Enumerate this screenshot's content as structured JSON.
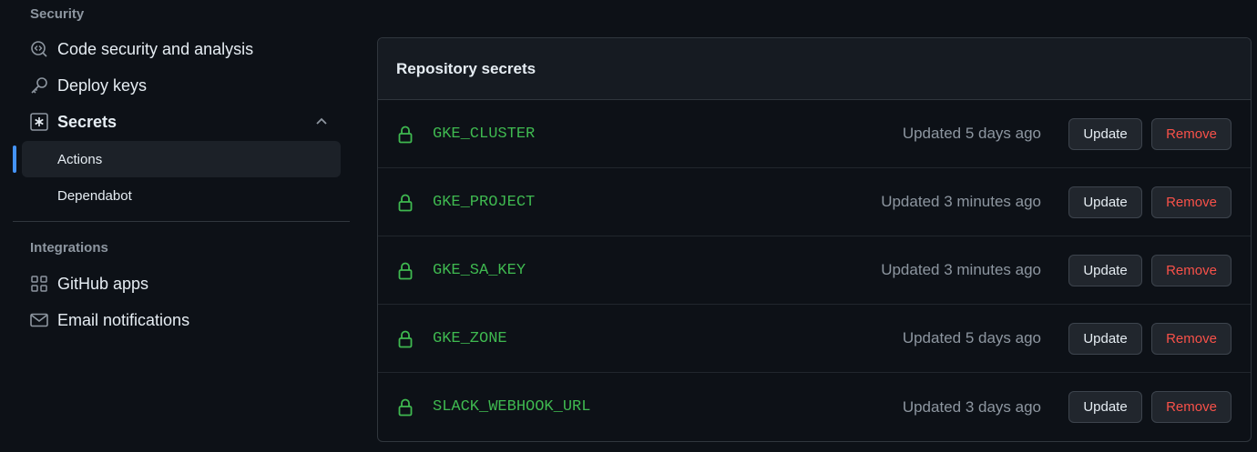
{
  "sidebar": {
    "security_heading": "Security",
    "items": [
      {
        "label": "Code security and analysis",
        "icon": "codescan-icon"
      },
      {
        "label": "Deploy keys",
        "icon": "key-icon"
      },
      {
        "label": "Secrets",
        "icon": "asterisk-icon"
      }
    ],
    "sub_items": [
      {
        "label": "Actions",
        "active": true
      },
      {
        "label": "Dependabot",
        "active": false
      }
    ],
    "integrations_heading": "Integrations",
    "integration_items": [
      {
        "label": "GitHub apps",
        "icon": "apps-icon"
      },
      {
        "label": "Email notifications",
        "icon": "mail-icon"
      }
    ]
  },
  "main": {
    "title": "Repository secrets",
    "update_label": "Update",
    "remove_label": "Remove",
    "secrets": [
      {
        "name": "GKE_CLUSTER",
        "updated": "Updated 5 days ago"
      },
      {
        "name": "GKE_PROJECT",
        "updated": "Updated 3 minutes ago"
      },
      {
        "name": "GKE_SA_KEY",
        "updated": "Updated 3 minutes ago"
      },
      {
        "name": "GKE_ZONE",
        "updated": "Updated 5 days ago"
      },
      {
        "name": "SLACK_WEBHOOK_URL",
        "updated": "Updated 3 days ago"
      }
    ]
  },
  "colors": {
    "accent": "#4493f8",
    "secret_name": "#3fb950",
    "danger": "#f85149"
  }
}
